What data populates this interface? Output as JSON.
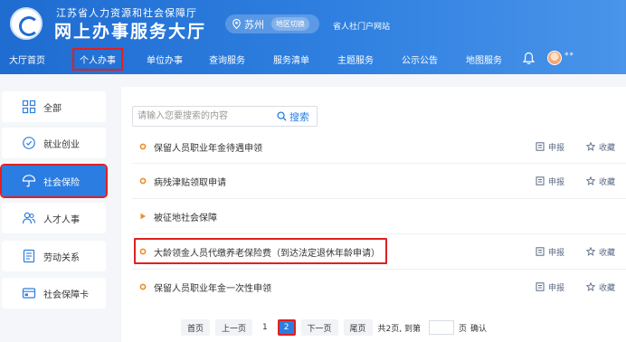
{
  "header": {
    "org_name": "江苏省人力资源和社会保障厅",
    "site_title": "网上办事服务大厅",
    "city": "苏州",
    "city_switch": "地区切换",
    "portal_link": "省人社门户网站",
    "user_name": "**"
  },
  "nav": {
    "items": [
      "大厅首页",
      "个人办事",
      "单位办事",
      "查询服务",
      "服务清单",
      "主题服务",
      "公示公告",
      "地图服务"
    ],
    "active_index": 1
  },
  "sidebar": {
    "items": [
      {
        "label": "全部",
        "icon": "grid-icon"
      },
      {
        "label": "就业创业",
        "icon": "badge-icon"
      },
      {
        "label": "社会保险",
        "icon": "umbrella-icon"
      },
      {
        "label": "人才人事",
        "icon": "people-icon"
      },
      {
        "label": "劳动关系",
        "icon": "document-icon"
      },
      {
        "label": "社会保障卡",
        "icon": "card-icon"
      }
    ],
    "active_index": 2
  },
  "search": {
    "placeholder": "请输入您要搜索的内容",
    "button_label": "搜索"
  },
  "services": [
    {
      "title": "保留人员职业年金待遇申领",
      "apply": "申报",
      "favorite": "收藏"
    },
    {
      "title": "病残津贴领取申请",
      "apply": "申报",
      "favorite": "收藏"
    },
    {
      "title": "被征地社会保障"
    },
    {
      "title": "大龄领金人员代缴养老保险费（到达法定退休年龄申请）",
      "apply": "申报",
      "favorite": "收藏"
    },
    {
      "title": "保留人员职业年金一次性申领",
      "apply": "申报",
      "favorite": "收藏"
    }
  ],
  "pagination": {
    "first": "首页",
    "prev": "上一页",
    "pages": [
      "1",
      "2"
    ],
    "current_page": "2",
    "next": "下一页",
    "last": "尾页",
    "summary_prefix": "共2页, 到第",
    "summary_suffix": "页",
    "confirm": "确认"
  },
  "colors": {
    "header_blue": "#1f6cd1",
    "accent_blue": "#2b7de1",
    "bullet_orange": "#f08a24",
    "highlight_red": "#e02020"
  }
}
